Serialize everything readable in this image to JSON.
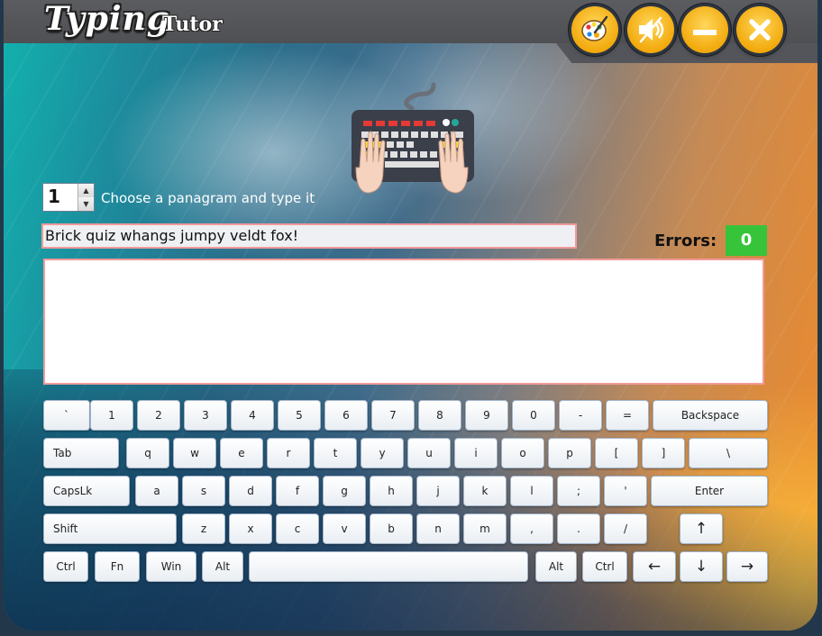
{
  "app": {
    "title_main": "Typing",
    "title_sub": "Tutor"
  },
  "title_buttons": [
    {
      "name": "theme",
      "icon": "palette-icon"
    },
    {
      "name": "mute",
      "icon": "speaker-muted-icon"
    },
    {
      "name": "minimize",
      "icon": "minimize-icon"
    },
    {
      "name": "close",
      "icon": "close-icon"
    }
  ],
  "controls": {
    "pangram_number": "1",
    "choose_label": "Choose a panagram and type it",
    "sentence": "Brick quiz whangs jumpy veldt fox!",
    "errors_label": "Errors:",
    "errors_value": "0",
    "input_value": ""
  },
  "keyboard": {
    "rows": [
      [
        "`",
        "1",
        "2",
        "3",
        "4",
        "5",
        "6",
        "7",
        "8",
        "9",
        "0",
        "-",
        "=",
        "Backspace"
      ],
      [
        "Tab",
        "q",
        "w",
        "e",
        "r",
        "t",
        "y",
        "u",
        "i",
        "o",
        "p",
        "[",
        "]",
        "\\"
      ],
      [
        "CapsLk",
        "a",
        "s",
        "d",
        "f",
        "g",
        "h",
        "j",
        "k",
        "l",
        ";",
        "'",
        "Enter"
      ],
      [
        "Shift",
        "z",
        "x",
        "c",
        "v",
        "b",
        "n",
        "m",
        ",",
        ".",
        "/",
        "↑"
      ],
      [
        "Ctrl",
        "Fn",
        "Win",
        "Alt",
        "",
        "Alt",
        "Ctrl",
        "←",
        "↓",
        "→"
      ]
    ]
  },
  "colors": {
    "accent_button": "#f2a90c",
    "error_badge": "#37c43a",
    "field_border": "#f29a9a",
    "titlebar": "#54555a"
  }
}
